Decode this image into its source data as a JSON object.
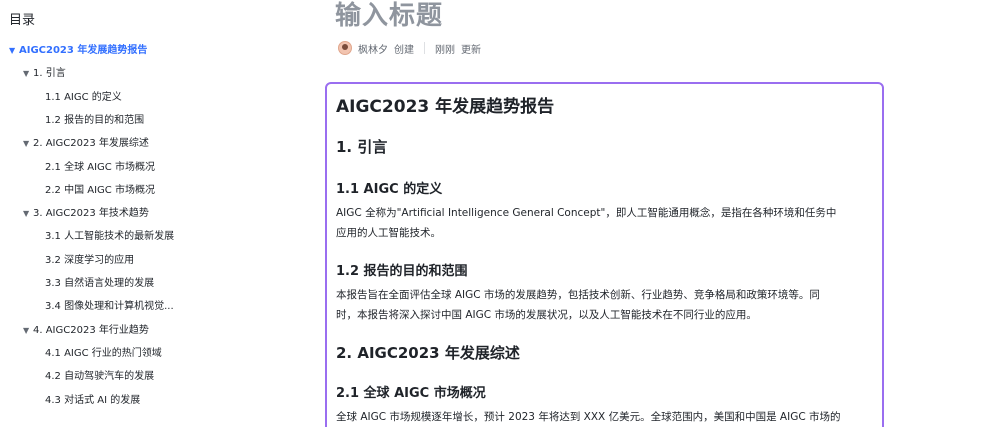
{
  "toc": {
    "title": "目录",
    "items": [
      {
        "label": "AIGC2023 年发展趋势报告",
        "level": 0,
        "active": true,
        "caret": "▼"
      },
      {
        "label": "1. 引言",
        "level": 1,
        "caret": "▼"
      },
      {
        "label": "1.1 AIGC 的定义",
        "level": 2
      },
      {
        "label": "1.2 报告的目的和范围",
        "level": 2
      },
      {
        "label": "2. AIGC2023 年发展综述",
        "level": 1,
        "caret": "▼"
      },
      {
        "label": "2.1 全球 AIGC 市场概况",
        "level": 2
      },
      {
        "label": "2.2 中国 AIGC 市场概况",
        "level": 2
      },
      {
        "label": "3. AIGC2023 年技术趋势",
        "level": 1,
        "caret": "▼"
      },
      {
        "label": "3.1 人工智能技术的最新发展",
        "level": 2
      },
      {
        "label": "3.2 深度学习的应用",
        "level": 2
      },
      {
        "label": "3.3 自然语言处理的发展",
        "level": 2
      },
      {
        "label": "3.4 图像处理和计算机视觉...",
        "level": 2
      },
      {
        "label": "4. AIGC2023 年行业趋势",
        "level": 1,
        "caret": "▼"
      },
      {
        "label": "4.1 AIGC 行业的热门领域",
        "level": 2
      },
      {
        "label": "4.2 自动驾驶汽车的发展",
        "level": 2
      },
      {
        "label": "4.3 对话式 AI 的发展",
        "level": 2
      }
    ]
  },
  "header": {
    "title": "输入标题",
    "author": "枫林夕",
    "created": "创建",
    "updated_time": "刚刚",
    "updated": "更新"
  },
  "document": {
    "h1": "AIGC2023 年发展趋势报告",
    "s1": "1. 引言",
    "s1_1": "1.1 AIGC 的定义",
    "s1_1_p1": "AIGC 全称为\"Artificial Intelligence General Concept\"，即人工智能通用概念，是指在各种环境和任务中",
    "s1_1_p2": "应用的人工智能技术。",
    "s1_2": "1.2 报告的目的和范围",
    "s1_2_p1": "本报告旨在全面评估全球 AIGC 市场的发展趋势，包括技术创新、行业趋势、竞争格局和政策环境等。同",
    "s1_2_p2": "时，本报告将深入探讨中国 AIGC 市场的发展状况，以及人工智能技术在不同行业的应用。",
    "s2": "2. AIGC2023 年发展综述",
    "s2_1": "2.1 全球 AIGC 市场概况",
    "s2_1_p1": "全球 AIGC 市场规模逐年增长，预计 2023 年将达到 XXX 亿美元。全球范围内，美国和中国是 AIGC 市场的"
  }
}
